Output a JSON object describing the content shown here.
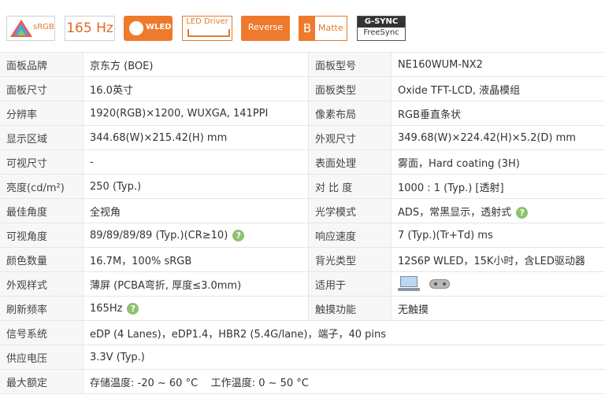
{
  "badges": {
    "srgb": "sRGB",
    "hz": "165 Hz",
    "wled": "WLED",
    "led_driver": "LED Driver",
    "reverse": "Reverse",
    "matte_letter": "B",
    "matte": "Matte",
    "gsync_top": "G-SYNC",
    "gsync_bottom": "FreeSync"
  },
  "rows": [
    {
      "k1": "面板品牌",
      "v1": "京东方 (BOE)",
      "k2": "面板型号",
      "v2": "NE160WUM-NX2"
    },
    {
      "k1": "面板尺寸",
      "v1": "16.0英寸",
      "k2": "面板类型",
      "v2": "Oxide TFT-LCD, 液晶模组"
    },
    {
      "k1": "分辨率",
      "v1": "1920(RGB)×1200, WUXGA, 141PPI",
      "k2": "像素布局",
      "v2": "RGB垂直条状"
    },
    {
      "k1": "显示区域",
      "v1": "344.68(W)×215.42(H) mm",
      "k2": "外观尺寸",
      "v2": "349.68(W)×224.42(H)×5.2(D) mm"
    },
    {
      "k1": "可视尺寸",
      "v1": "-",
      "k2": "表面处理",
      "v2": "雾面，Hard coating (3H)"
    },
    {
      "k1": "亮度(cd/m²)",
      "v1": "250 (Typ.)",
      "k2": "对 比 度",
      "v2": "1000 : 1 (Typ.) [透射]"
    },
    {
      "k1": "最佳角度",
      "v1": "全视角",
      "k2": "光学模式",
      "v2": "ADS，常黑显示，透射式"
    },
    {
      "k1": "可视角度",
      "v1": "89/89/89/89 (Typ.)(CR≥10)",
      "k2": "响应速度",
      "v2": "7 (Typ.)(Tr+Td) ms"
    },
    {
      "k1": "颜色数量",
      "v1": "16.7M，100% sRGB",
      "k2": "背光类型",
      "v2": "12S6P WLED，15K小时，含LED驱动器"
    },
    {
      "k1": "外观样式",
      "v1": "薄屏 (PCBA弯折, 厚度≤3.0mm)",
      "k2": "适用于",
      "v2": ""
    },
    {
      "k1": "刷新频率",
      "v1": "165Hz",
      "k2": "触摸功能",
      "v2": "无触摸"
    }
  ],
  "wide_rows": [
    {
      "k": "信号系统",
      "v": "eDP (4 Lanes)，eDP1.4，HBR2 (5.4G/lane)，端子，40 pins"
    },
    {
      "k": "供应电压",
      "v": "3.3V (Typ.)"
    },
    {
      "k": "最大额定",
      "v": "存储温度: -20 ~ 60 °C    工作温度: 0 ~ 50 °C"
    }
  ],
  "help_glyph": "?",
  "icons": {
    "help": "question-circle-icon",
    "laptop": "laptop-icon",
    "gamepad": "gamepad-icon"
  },
  "colors": {
    "accent": "#ef7a2c",
    "link": "#2a6fb0",
    "help": "#8dc26f",
    "label_bg": "#f7f7f7"
  }
}
